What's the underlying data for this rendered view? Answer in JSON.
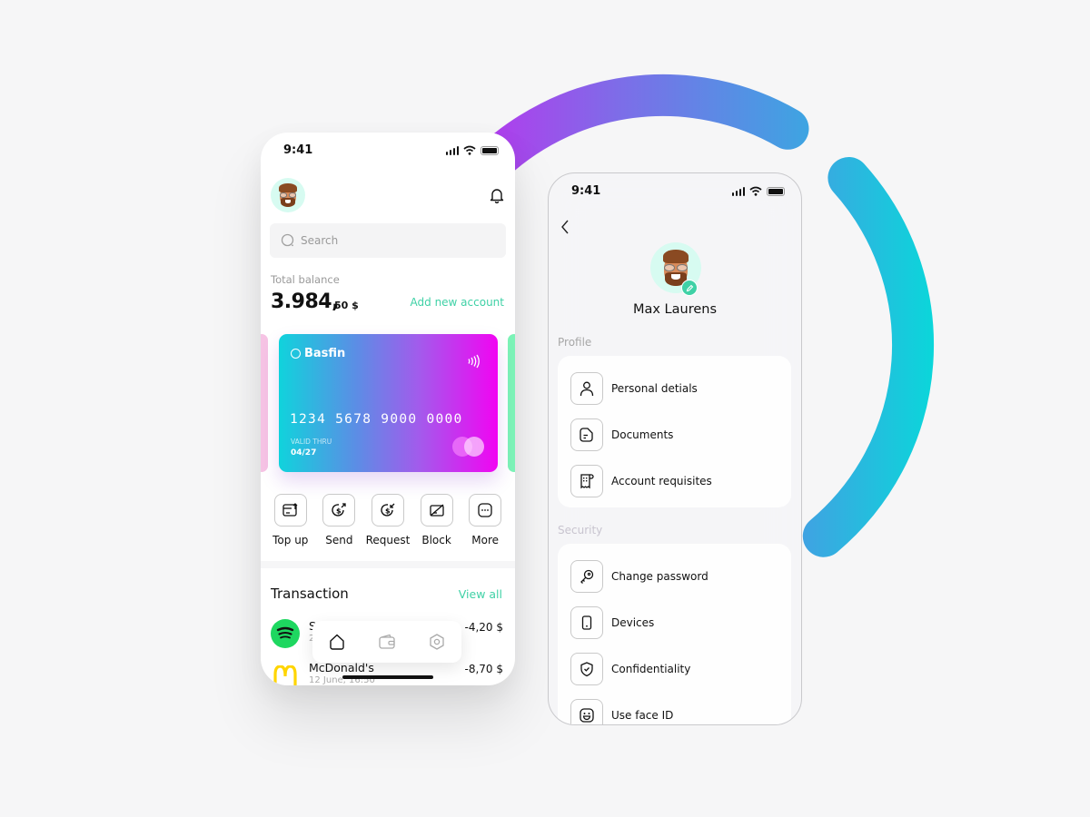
{
  "decoration": {
    "ring_gradient": [
      "#d21ff0",
      "#7d6de8",
      "#3fa3e2",
      "#0ad7da"
    ]
  },
  "status_bar": {
    "time": "9:41"
  },
  "home_screen": {
    "search": {
      "placeholder": "Search"
    },
    "balance": {
      "label": "Total balance",
      "value": "3.984,",
      "cents": "50 $",
      "add_account_label": "Add new account"
    },
    "card": {
      "brand": "Basfin",
      "number": "1234 5678 9000 0000",
      "valid_label": "VALID THRU",
      "valid_date": "04/27",
      "colors": {
        "start": "#10d3dc",
        "end": "#f104f2",
        "prev_card": "#f6c3e4",
        "next_card": "#7cf3b7"
      }
    },
    "actions": [
      {
        "label": "Top up",
        "icon": "top-up-icon"
      },
      {
        "label": "Send",
        "icon": "send-money-icon"
      },
      {
        "label": "Request",
        "icon": "request-money-icon"
      },
      {
        "label": "Block",
        "icon": "block-card-icon"
      },
      {
        "label": "More",
        "icon": "more-icon"
      }
    ],
    "transactions": {
      "title": "Transaction",
      "view_all_label": "View all",
      "items": [
        {
          "name": "S",
          "date": "2",
          "amount": "-4,20 $",
          "icon": "spotify-logo"
        },
        {
          "name": "McDonald's",
          "date": "12 June, 16:50",
          "amount": "-8,70 $",
          "icon": "mcdonalds-logo"
        }
      ]
    },
    "tab_bar": [
      {
        "name": "home",
        "icon": "home-icon",
        "active": true
      },
      {
        "name": "wallet",
        "icon": "wallet-icon",
        "active": false
      },
      {
        "name": "settings",
        "icon": "settings-icon",
        "active": false
      }
    ],
    "accent_color": "#3fd1a6"
  },
  "profile_screen": {
    "user_name": "Max Laurens",
    "sections": [
      {
        "label": "Profile",
        "items": [
          {
            "label": "Personal detials",
            "icon": "user-icon"
          },
          {
            "label": "Documents",
            "icon": "document-icon"
          },
          {
            "label": "Account requisites",
            "icon": "receipt-icon"
          }
        ]
      },
      {
        "label": "Security",
        "items": [
          {
            "label": "Change password",
            "icon": "key-icon"
          },
          {
            "label": "Devices",
            "icon": "phone-device-icon"
          },
          {
            "label": "Confidentiality",
            "icon": "shield-check-icon"
          },
          {
            "label": "Use face ID",
            "icon": "face-id-icon"
          }
        ]
      }
    ]
  }
}
